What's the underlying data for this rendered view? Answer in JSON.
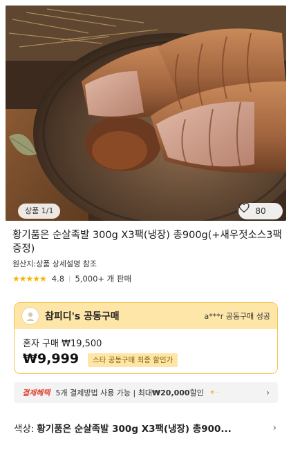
{
  "hero": {
    "counter": "상품 1/1",
    "likes": "80"
  },
  "product": {
    "title": "황기품은 순살족발 300g X3팩(냉장) 총900g(+새우젓소스3팩증정)",
    "origin": "원산지:상품 상세설명 참조",
    "stars": "★★★★★",
    "rating": "4.8",
    "sold": "5,000+ 개 판매"
  },
  "group_buy": {
    "title": "참피디's 공동구매",
    "success": "a***r 공동구매 성공",
    "solo_label": "혼자 구매 ₩19,500",
    "price": "₩9,999",
    "badge": "스타 공동구매 최종 할인가"
  },
  "benefit": {
    "label": "결제혜택",
    "text_prefix": "5개 결제방법 사용 가능 | 최대 ",
    "amount": "₩20,000",
    "text_suffix": " 할인",
    "chevron": "›"
  },
  "option": {
    "label": "색상:",
    "value": "황기품은 순살족발 300g X3팩(냉장) 총900...",
    "chevron": "›"
  },
  "icons": {
    "heart": "heart-icon",
    "avatar": "avatar-icon",
    "sparkle": "sparkle-icon"
  }
}
